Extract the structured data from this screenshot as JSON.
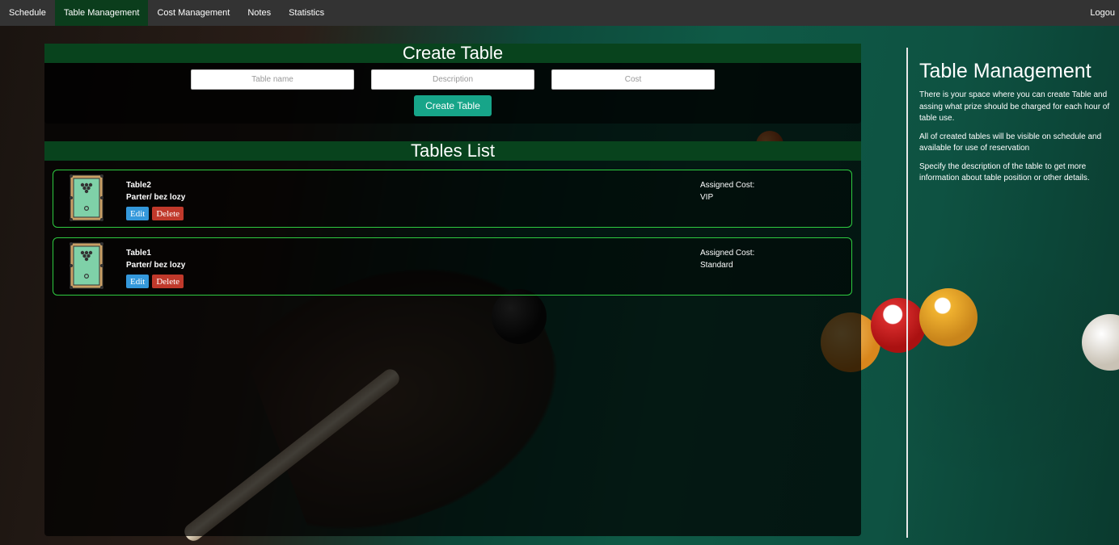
{
  "nav": {
    "items": [
      {
        "label": "Schedule",
        "active": false
      },
      {
        "label": "Table Management",
        "active": true
      },
      {
        "label": "Cost Management",
        "active": false
      },
      {
        "label": "Notes",
        "active": false
      },
      {
        "label": "Statistics",
        "active": false
      }
    ],
    "logout": "Logou"
  },
  "create": {
    "title": "Create Table",
    "name_placeholder": "Table name",
    "description_placeholder": "Description",
    "cost_placeholder": "Cost",
    "button": "Create Table"
  },
  "list": {
    "title": "Tables List",
    "cost_label": "Assigned Cost:",
    "edit_label": "Edit",
    "delete_label": "Delete",
    "tables": [
      {
        "name": "Table2",
        "description": "Parter/ bez lozy",
        "cost": "VIP"
      },
      {
        "name": "Table1",
        "description": "Parter/ bez lozy",
        "cost": "Standard"
      }
    ]
  },
  "side": {
    "title": "Table Management",
    "paragraphs": [
      "There is your space where you can create Table and assing what prize should be charged for each hour of table use.",
      "All of created tables will be visible on schedule and available for use of reservation",
      "Specify the description of the table to get more information about table position or other details."
    ]
  },
  "colors": {
    "nav_bg": "#333333",
    "nav_active": "#0b3d1c",
    "header_green": "#08431d",
    "create_button": "#17a589",
    "card_border": "#2ecc40",
    "edit": "#3498db",
    "delete": "#c0392b"
  }
}
